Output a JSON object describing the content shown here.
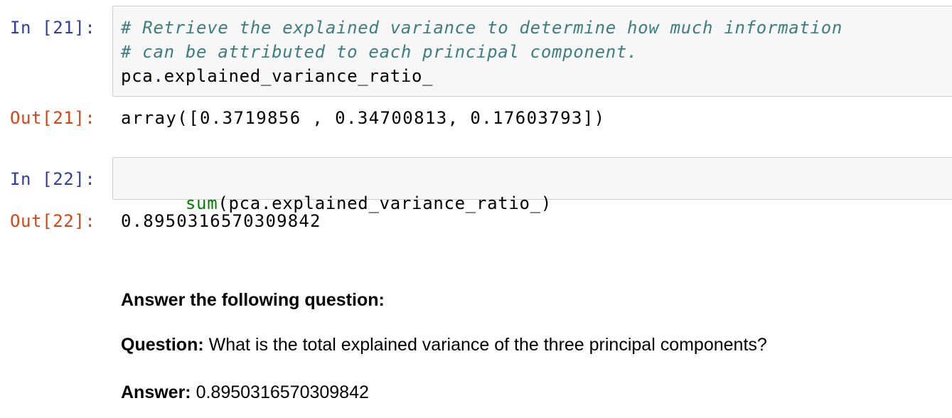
{
  "cells": [
    {
      "in_prompt": "In [21]:",
      "code_lines": [
        {
          "type": "comment",
          "text": "# Retrieve the explained variance to determine how much information"
        },
        {
          "type": "comment",
          "text": "# can be attributed to each principal component."
        },
        {
          "type": "code",
          "text": "pca.explained_variance_ratio_"
        }
      ],
      "out_prompt": "Out[21]:",
      "output": "array([0.3719856 , 0.34700813, 0.17603793])"
    },
    {
      "in_prompt": "In [22]:",
      "code": {
        "builtin": "sum",
        "rest": "(pca.explained_variance_ratio_)"
      },
      "out_prompt": "Out[22]:",
      "output": "0.8950316570309842"
    }
  ],
  "markdown": {
    "heading": "Answer the following question:",
    "question_label": "Question:",
    "question_text": " What is the total explained variance of the three principal components?",
    "answer_label": "Answer:",
    "answer_text": " 0.8950316570309842"
  }
}
